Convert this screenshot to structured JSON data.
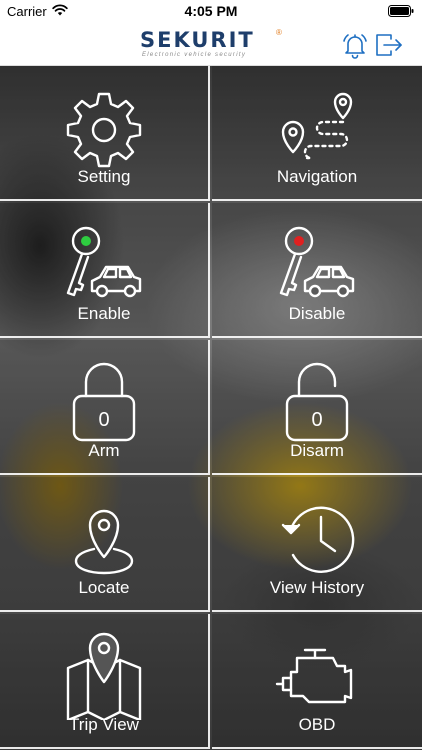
{
  "status_bar": {
    "carrier": "Carrier",
    "time": "4:05 PM"
  },
  "header": {
    "logo_text_main": "SEKUR",
    "logo_text_accent": "IT",
    "logo_reg": "®",
    "logo_tagline": "Electronic vehicle security",
    "accent_color": "#1e6fc2"
  },
  "tiles": [
    {
      "label": "Setting",
      "icon": "gear-icon"
    },
    {
      "label": "Navigation",
      "icon": "route-pins-icon"
    },
    {
      "label": "Enable",
      "icon": "key-car-green-icon"
    },
    {
      "label": "Disable",
      "icon": "key-car-red-icon"
    },
    {
      "label": "Arm",
      "icon": "lock-closed-icon",
      "lock_digit": "0"
    },
    {
      "label": "Disarm",
      "icon": "lock-open-icon",
      "lock_digit": "0"
    },
    {
      "label": "Locate",
      "icon": "location-pin-icon"
    },
    {
      "label": "View History",
      "icon": "history-clock-icon"
    },
    {
      "label": "Trip View",
      "icon": "map-pin-icon"
    },
    {
      "label": "OBD",
      "icon": "engine-icon"
    }
  ],
  "colors": {
    "enable_dot": "#2ecc40",
    "disable_dot": "#e02020",
    "tile_border": "#ffffff"
  }
}
